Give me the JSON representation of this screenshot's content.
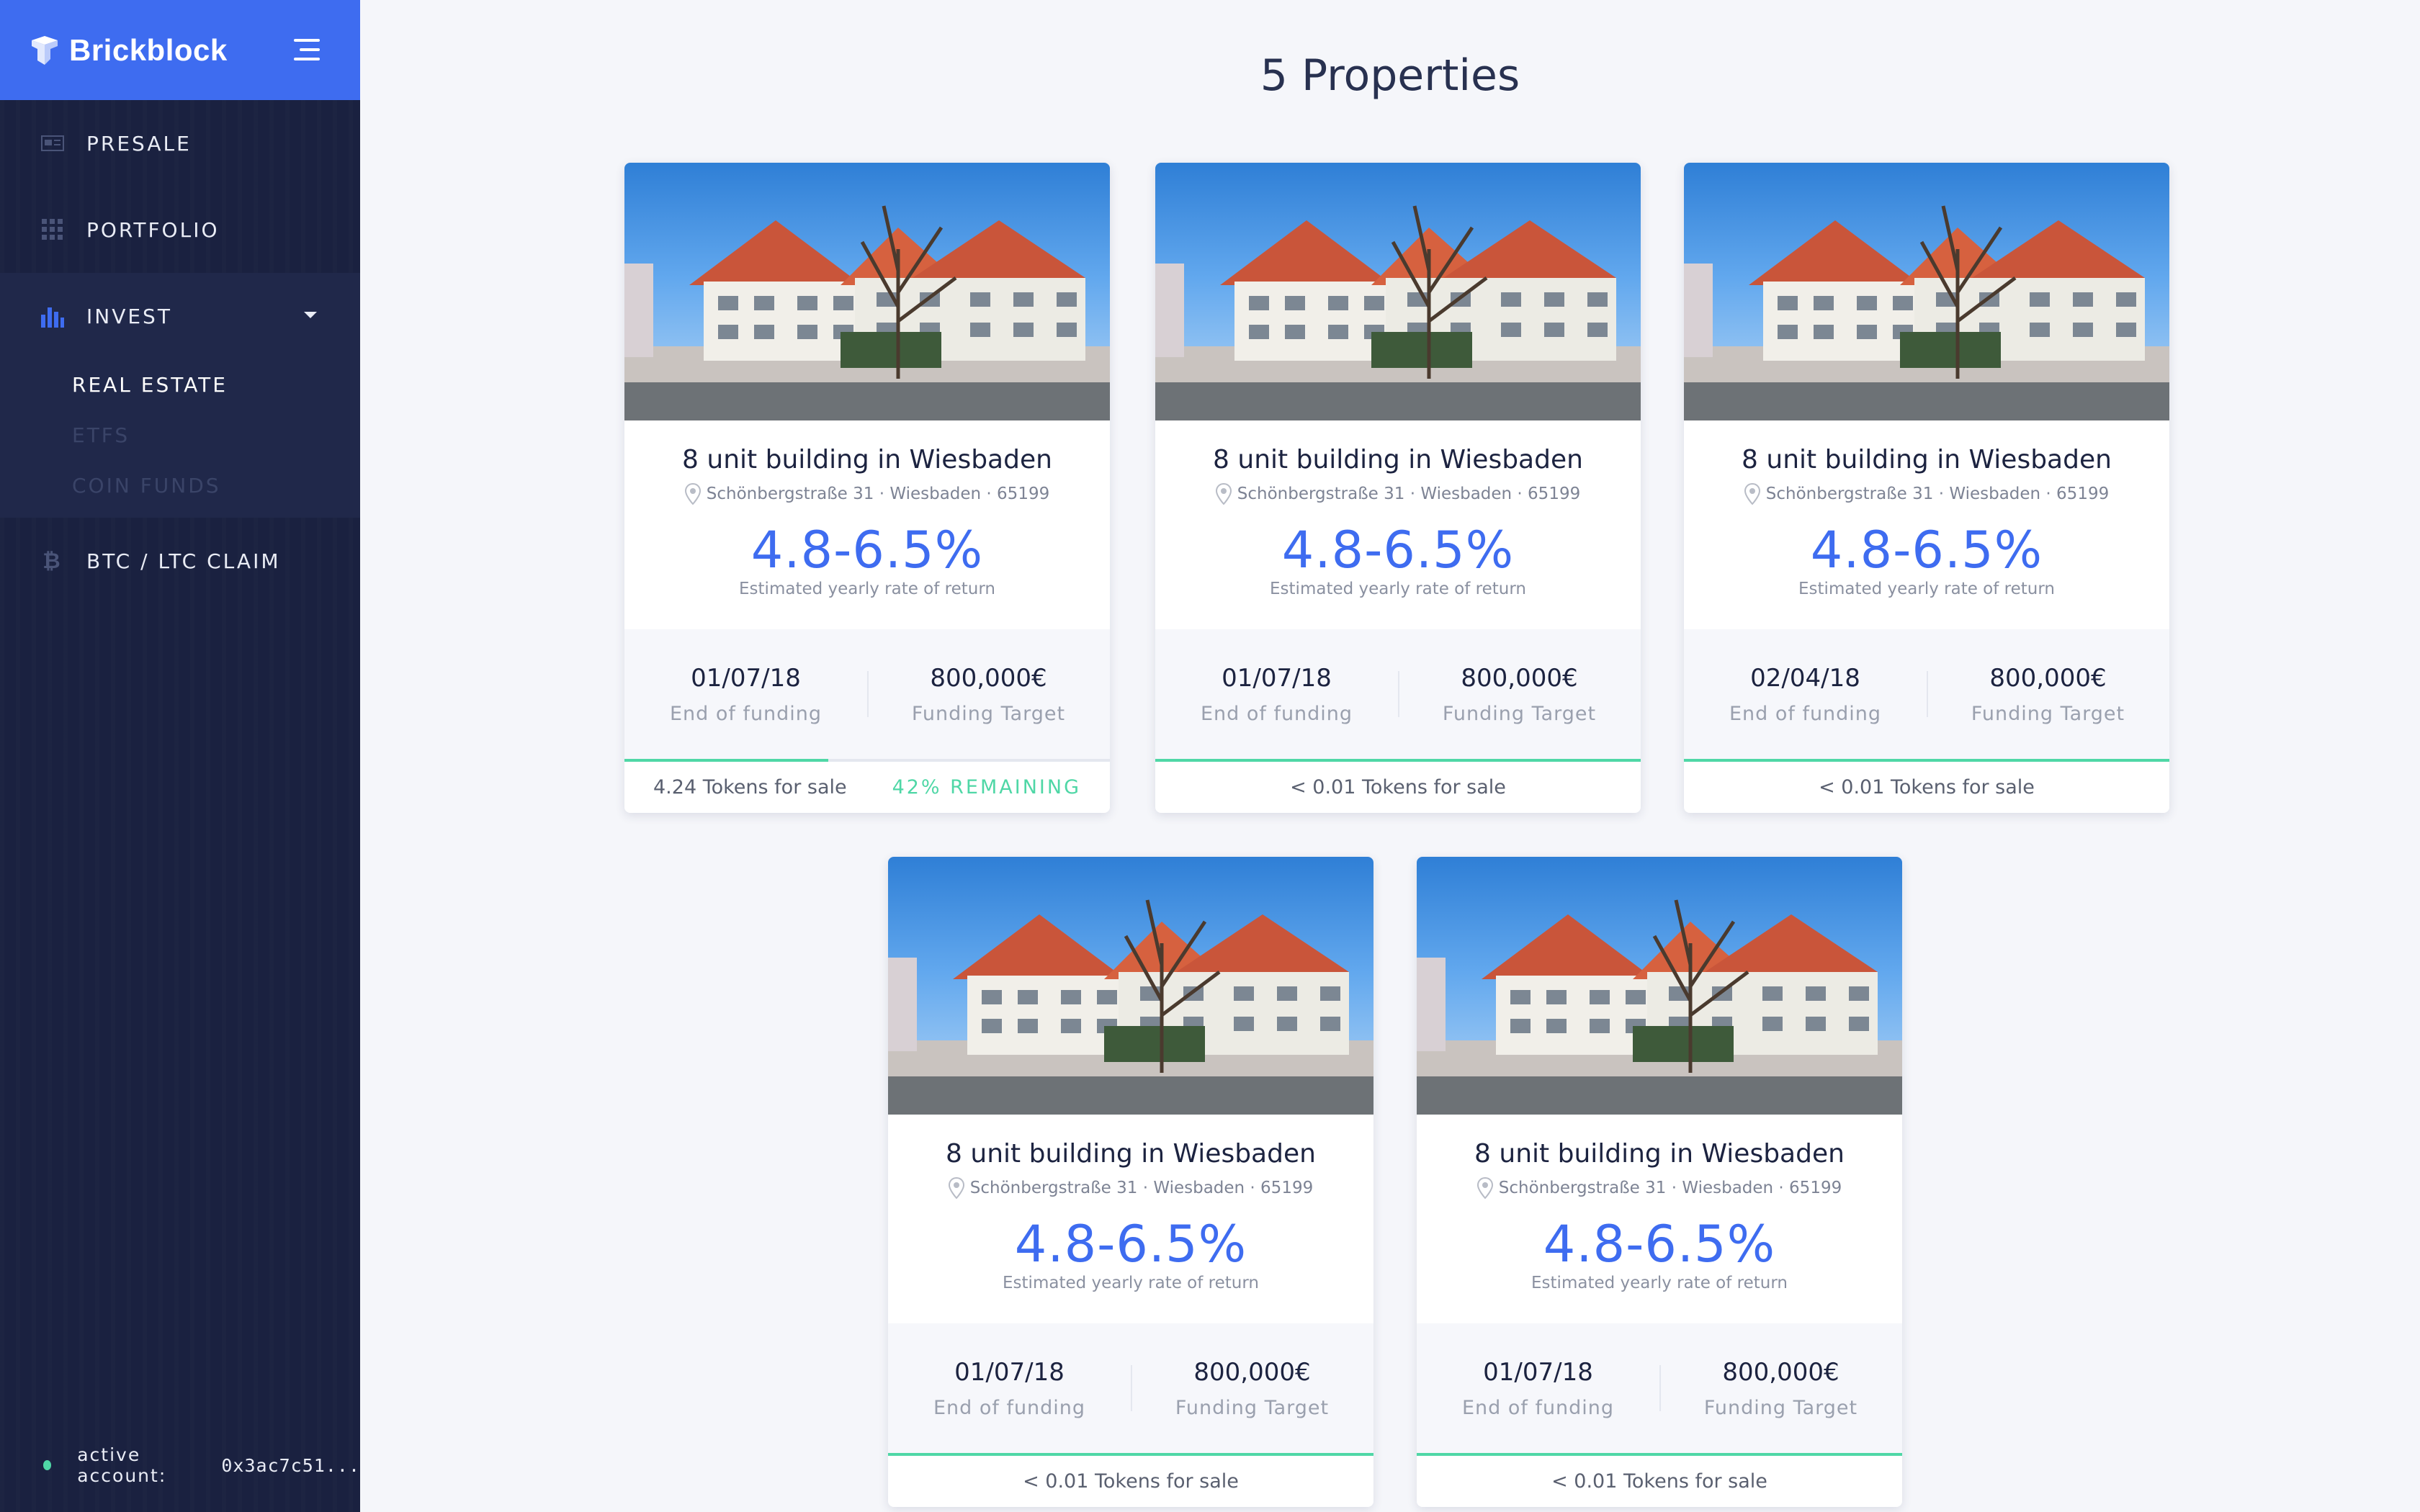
{
  "app": {
    "brand": "Brickblock"
  },
  "sidebar": {
    "items": [
      {
        "label": "PRESALE"
      },
      {
        "label": "PORTFOLIO"
      },
      {
        "label": "INVEST"
      },
      {
        "label": "BTC / LTC CLAIM"
      }
    ],
    "invest_sub": [
      {
        "label": "REAL ESTATE",
        "active": true
      },
      {
        "label": "ETFS",
        "active": false
      },
      {
        "label": "COIN FUNDS",
        "active": false
      }
    ],
    "account_label": "active account:",
    "account_value": "0x3ac7c51..."
  },
  "page": {
    "title": "5 Properties"
  },
  "cards": [
    {
      "name": "8 unit building in Wiesbaden",
      "address": "Schönbergstraße 31 · Wiesbaden · 65199",
      "rate": "4.8-6.5%",
      "rate_label": "Estimated yearly rate of return",
      "end_date": "01/07/18",
      "end_label": "End of funding",
      "target": "800,000€",
      "target_label": "Funding Target",
      "progress": 0.42,
      "tokens": "4.24 Tokens for sale",
      "remaining": "42% REMAINING"
    },
    {
      "name": "8 unit building in Wiesbaden",
      "address": "Schönbergstraße 31 · Wiesbaden · 65199",
      "rate": "4.8-6.5%",
      "rate_label": "Estimated yearly rate of return",
      "end_date": "01/07/18",
      "end_label": "End of funding",
      "target": "800,000€",
      "target_label": "Funding Target",
      "progress": 1.0,
      "tokens": "< 0.01 Tokens for sale"
    },
    {
      "name": "8 unit building in Wiesbaden",
      "address": "Schönbergstraße 31 · Wiesbaden · 65199",
      "rate": "4.8-6.5%",
      "rate_label": "Estimated yearly rate of return",
      "end_date": "02/04/18",
      "end_label": "End of funding",
      "target": "800,000€",
      "target_label": "Funding Target",
      "progress": 1.0,
      "tokens": "< 0.01 Tokens for sale"
    },
    {
      "name": "8 unit building in Wiesbaden",
      "address": "Schönbergstraße 31 · Wiesbaden · 65199",
      "rate": "4.8-6.5%",
      "rate_label": "Estimated yearly rate of return",
      "end_date": "01/07/18",
      "end_label": "End of funding",
      "target": "800,000€",
      "target_label": "Funding Target",
      "progress": 1.0,
      "tokens": "< 0.01 Tokens for sale"
    },
    {
      "name": "8 unit building in Wiesbaden",
      "address": "Schönbergstraße 31 · Wiesbaden · 65199",
      "rate": "4.8-6.5%",
      "rate_label": "Estimated yearly rate of return",
      "end_date": "01/07/18",
      "end_label": "End of funding",
      "target": "800,000€",
      "target_label": "Funding Target",
      "progress": 1.0,
      "tokens": "< 0.01 Tokens for sale"
    }
  ],
  "colors": {
    "accent": "#3e6cf0",
    "sidebar": "#1a2140",
    "success": "#4fd7a6"
  }
}
